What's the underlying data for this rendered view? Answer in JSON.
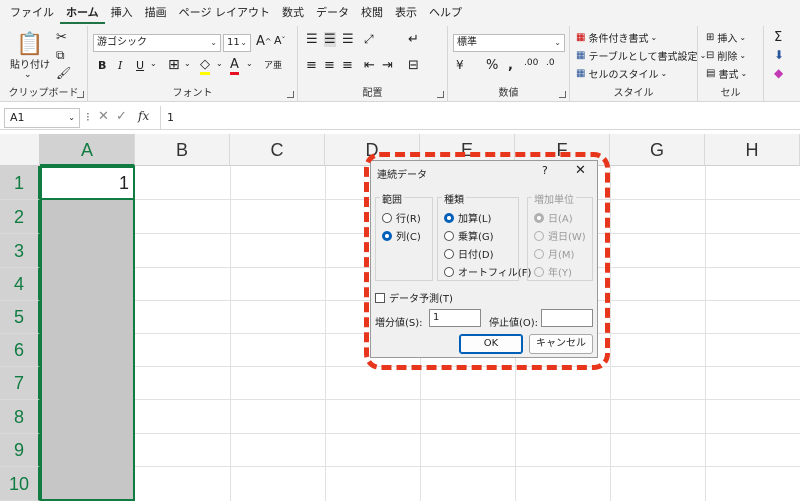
{
  "menu": [
    "ファイル",
    "ホーム",
    "挿入",
    "描画",
    "ページ レイアウト",
    "数式",
    "データ",
    "校閲",
    "表示",
    "ヘルプ"
  ],
  "ribbon": {
    "clipboard": {
      "label": "クリップボード",
      "paste": "貼り付け"
    },
    "font": {
      "label": "フォント",
      "name": "游ゴシック",
      "size": "11"
    },
    "align": {
      "label": "配置"
    },
    "number": {
      "label": "数値",
      "format": "標準"
    },
    "style": {
      "label": "スタイル",
      "conditional": "条件付き書式",
      "table": "テーブルとして書式設定",
      "cellstyle": "セルのスタイル"
    },
    "cells": {
      "label": "セル",
      "insert": "挿入",
      "delete": "削除",
      "format": "書式"
    }
  },
  "formula_bar": {
    "name_box": "A1",
    "fx": "fx",
    "value": "1"
  },
  "grid": {
    "columns": [
      "A",
      "B",
      "C",
      "D",
      "E",
      "F",
      "G",
      "H"
    ],
    "rows": [
      "1",
      "2",
      "3",
      "4",
      "5",
      "6",
      "7",
      "8",
      "9",
      "10"
    ],
    "a1_value": "1"
  },
  "dialog": {
    "title": "連続データ",
    "help": "?",
    "close": "✕",
    "range_label": "範囲",
    "range_row": "行(R)",
    "range_col": "列(C)",
    "type_label": "種類",
    "type_linear": "加算(L)",
    "type_growth": "乗算(G)",
    "type_date": "日付(D)",
    "type_autofill": "オートフィル(F)",
    "unit_label": "増加単位",
    "unit_day": "日(A)",
    "unit_weekday": "週日(W)",
    "unit_month": "月(M)",
    "unit_year": "年(Y)",
    "trend": "データ予測(T)",
    "step_label": "増分値(S):",
    "step_value": "1",
    "stop_label": "停止値(O):",
    "stop_value": "",
    "ok": "OK",
    "cancel": "キャンセル"
  },
  "colors": {
    "accent": "#107c41",
    "highlight": "#e8361d",
    "selection": "#c6c6c6"
  }
}
